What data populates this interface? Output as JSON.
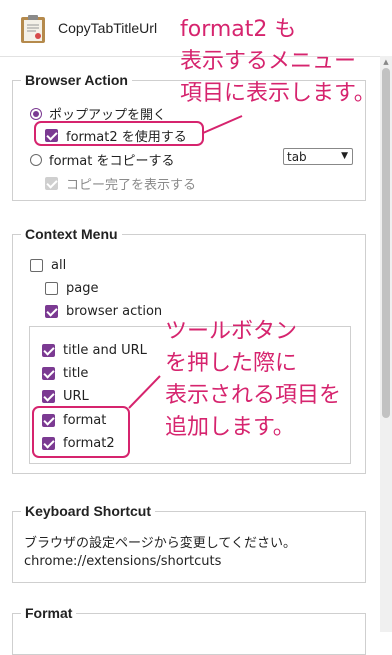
{
  "app": {
    "title": "CopyTabTitleUrl",
    "icon": "clipboard-icon"
  },
  "annotations": {
    "top": [
      "format2 も",
      "表示するメニュー",
      "項目に表示します。"
    ],
    "middle": [
      "ツールボタン",
      "を押した際に",
      "表示される項目を",
      "追加します。"
    ],
    "color": "#d6246e"
  },
  "browser_action": {
    "legend": "Browser Action",
    "open_popup": "ポップアップを開く",
    "use_format2": "format2 を使用する",
    "copy_format": "format をコピーする",
    "format_select": "tab",
    "show_done": "コピー完了を表示する"
  },
  "context_menu": {
    "legend": "Context Menu",
    "all": "all",
    "page": "page",
    "browser_action": "browser action",
    "items": [
      "title and URL",
      "title",
      "URL",
      "format",
      "format2"
    ]
  },
  "keyboard": {
    "legend": "Keyboard Shortcut",
    "desc": "ブラウザの設定ページから変更してください。",
    "url": "chrome://extensions/shortcuts"
  },
  "format": {
    "legend": "Format"
  },
  "accent": "#7b3a92"
}
